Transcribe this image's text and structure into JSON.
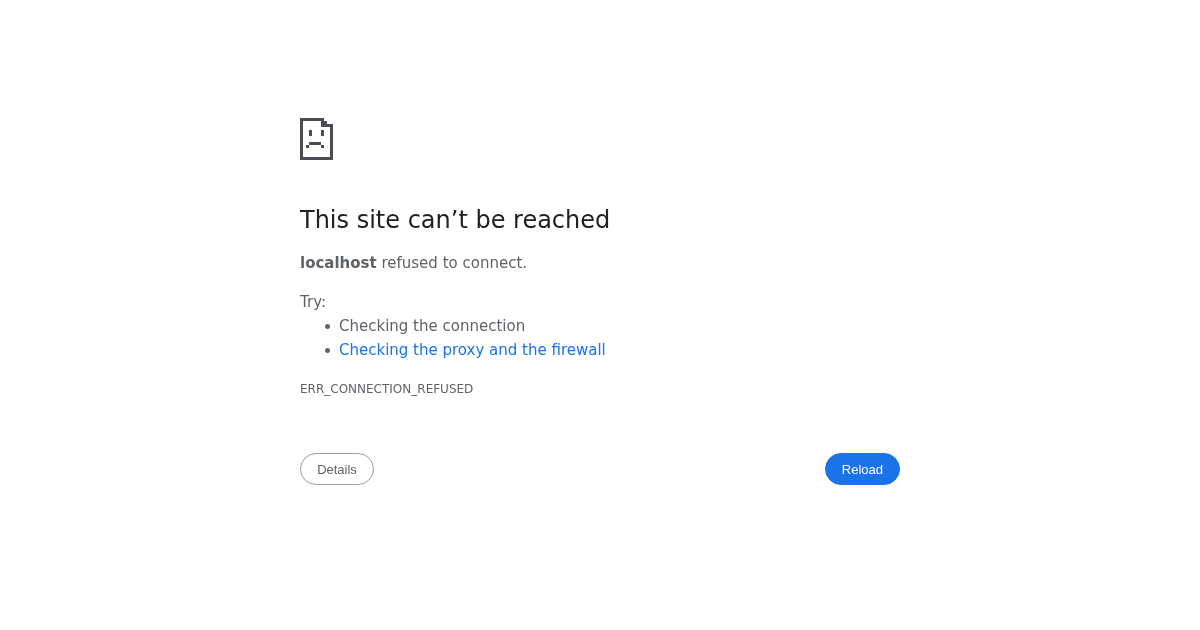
{
  "heading": "This site can’t be reached",
  "summary": "**localhost** refused to connect.",
  "suggestions": {
    "label": "Try:",
    "items": [
      {
        "kind": "text",
        "text": "Checking the connection"
      },
      {
        "kind": "link",
        "text": "Checking the proxy and the firewall"
      }
    ]
  },
  "error_code": "ERR_CONNECTION_REFUSED",
  "buttons": [
    {
      "kind": "secondary",
      "label": "Details"
    },
    {
      "kind": "primary",
      "label": "Reload"
    }
  ]
}
